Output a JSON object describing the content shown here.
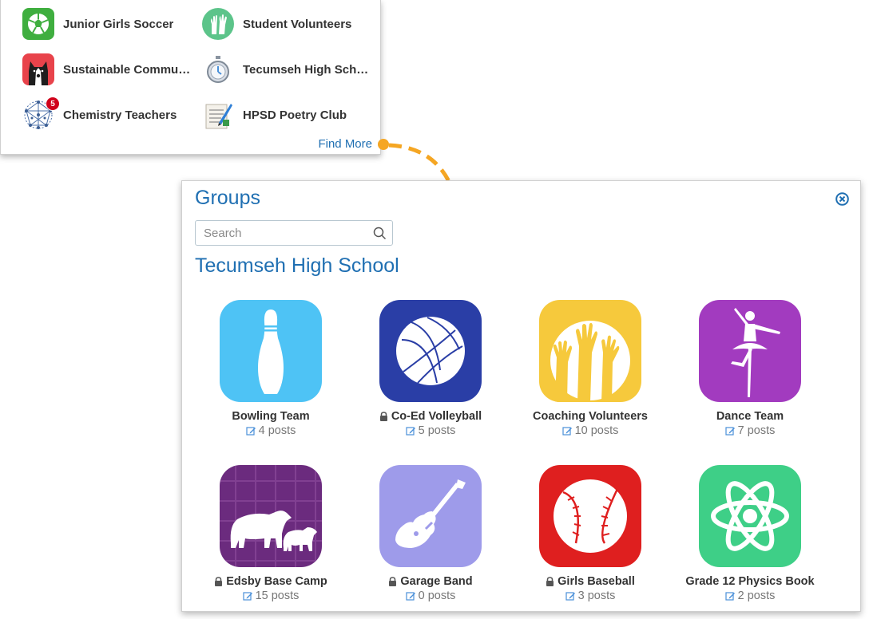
{
  "top_card": {
    "items": [
      {
        "label": "Junior Girls Soccer",
        "icon": "soccer-ball-icon",
        "color": "#3fae3f"
      },
      {
        "label": "Student Volunteers",
        "icon": "raised-hands-icon",
        "color": "#5cc48a"
      },
      {
        "label": "Sustainable Communit…",
        "icon": "dog-icon",
        "color": "#e8434b"
      },
      {
        "label": "Tecumseh High School…",
        "icon": "stopwatch-icon",
        "color": "#9aa6b5"
      },
      {
        "label": "Chemistry Teachers",
        "icon": "molecule-icon",
        "badge": "5"
      },
      {
        "label": "HPSD Poetry Club",
        "icon": "poetry-scroll-icon"
      }
    ],
    "find_more": "Find More"
  },
  "panel": {
    "title": "Groups",
    "search_placeholder": "Search",
    "school": "Tecumseh High School",
    "groups": [
      {
        "name": "Bowling Team",
        "posts": "4 posts",
        "locked": false,
        "icon": "bowling-pin-icon",
        "color": "#4ec3f5"
      },
      {
        "name": "Co-Ed Volleyball",
        "posts": "5 posts",
        "locked": true,
        "icon": "volleyball-icon",
        "color": "#2a3ea6"
      },
      {
        "name": "Coaching Volunteers",
        "posts": "10 posts",
        "locked": false,
        "icon": "raised-hands-icon",
        "color": "#f6c93c"
      },
      {
        "name": "Dance Team",
        "posts": "7 posts",
        "locked": false,
        "icon": "ballerina-icon",
        "color": "#a23bbf"
      },
      {
        "name": "Edsby Base Camp",
        "posts": "15 posts",
        "locked": true,
        "icon": "bears-icon",
        "color": "#6b2b7e"
      },
      {
        "name": "Garage Band",
        "posts": "0 posts",
        "locked": true,
        "icon": "guitar-icon",
        "color": "#9e9bea"
      },
      {
        "name": "Girls Baseball",
        "posts": "3 posts",
        "locked": true,
        "icon": "baseball-icon",
        "color": "#df1f1f"
      },
      {
        "name": "Grade 12 Physics Book",
        "posts": "2 posts",
        "locked": false,
        "icon": "atom-icon",
        "color": "#3ecf87"
      }
    ]
  },
  "colors": {
    "link": "#1f6fb2",
    "arrow": "#f5a623"
  }
}
